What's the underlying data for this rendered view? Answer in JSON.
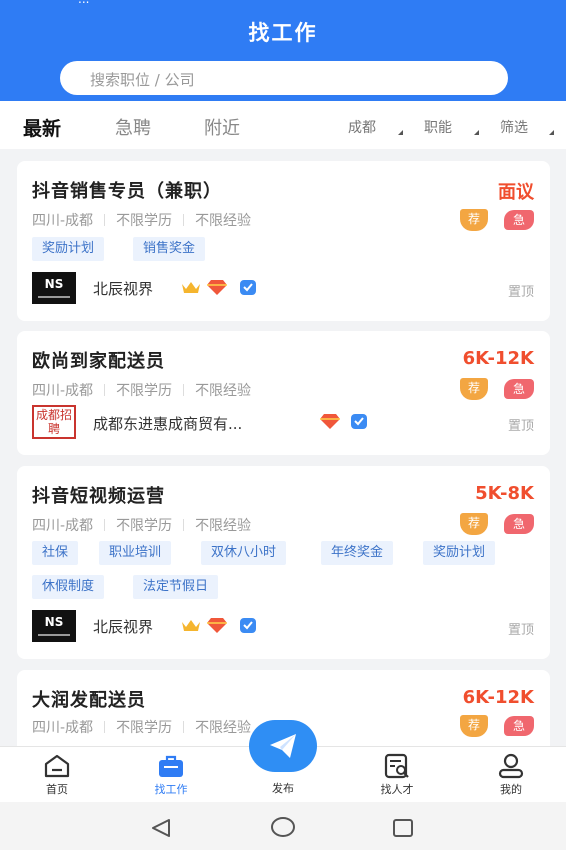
{
  "status_fragment": "...",
  "header": {
    "title": "找工作",
    "search_placeholder": "搜索职位 / 公司"
  },
  "tabs": [
    {
      "label": "最新",
      "active": true
    },
    {
      "label": "急聘",
      "active": false
    },
    {
      "label": "附近",
      "active": false
    }
  ],
  "filters": [
    "成都",
    "职能",
    "筛选"
  ],
  "badges": {
    "recommend": "荐",
    "urgent": "急"
  },
  "jobs": [
    {
      "title": "抖音销售专员（兼职）",
      "salary": "面议",
      "location": "四川-成都",
      "education": "不限学历",
      "experience": "不限经验",
      "tags": [
        "奖励计划",
        "销售奖金"
      ],
      "company": "北辰视界",
      "logo_text": "NS",
      "pin": "置顶"
    },
    {
      "title": "欧尚到家配送员",
      "salary": "6K-12K",
      "location": "四川-成都",
      "education": "不限学历",
      "experience": "不限经验",
      "tags": [],
      "company": "成都东进惠成商贸有...",
      "logo_text": "成都招聘",
      "pin": "置顶"
    },
    {
      "title": "抖音短视频运营",
      "salary": "5K-8K",
      "location": "四川-成都",
      "education": "不限学历",
      "experience": "不限经验",
      "tags": [
        "社保",
        "职业培训",
        "双休八小时",
        "年终奖金",
        "奖励计划",
        "休假制度",
        "法定节假日"
      ],
      "company": "北辰视界",
      "logo_text": "NS",
      "pin": "置顶"
    },
    {
      "title": "大润发配送员",
      "salary": "6K-12K",
      "location": "四川-成都",
      "education": "不限学历",
      "experience": "不限经验",
      "tags": []
    }
  ],
  "bottom_nav": [
    {
      "label": "首页",
      "icon": "home-icon"
    },
    {
      "label": "找工作",
      "icon": "briefcase-icon",
      "active": true
    },
    {
      "label": "发布",
      "icon": "paper-plane-icon"
    },
    {
      "label": "找人才",
      "icon": "resume-search-icon"
    },
    {
      "label": "我的",
      "icon": "user-icon"
    }
  ],
  "colors": {
    "brand": "#2f7cf4",
    "salary": "#f04e2e",
    "tag_bg": "#ebf2fd",
    "tag_text": "#3d73c8"
  }
}
